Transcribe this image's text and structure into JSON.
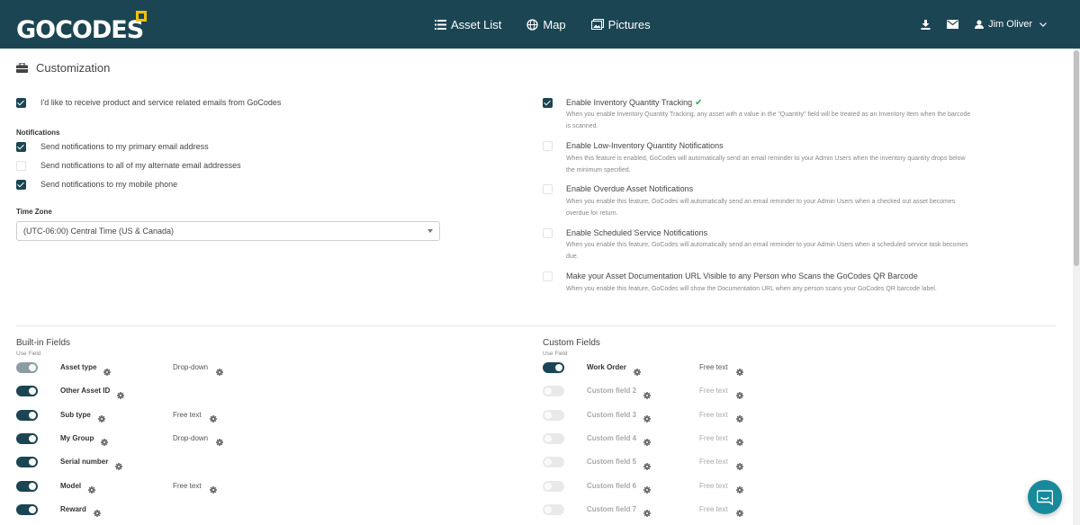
{
  "nav": {
    "logo": "GOCODES",
    "links": [
      "Asset List",
      "Map",
      "Pictures"
    ],
    "user": "Jim Oliver"
  },
  "page": {
    "title": "Customization",
    "marketing_email": "I'd like to receive product and service related emails from GoCodes",
    "notifications_heading": "Notifications",
    "notify_primary": "Send notifications to my primary email address",
    "notify_alternate": "Send notifications to all of my alternate email addresses",
    "notify_mobile": "Send notifications to my mobile phone",
    "timezone_label": "Time Zone",
    "timezone_value": "(UTC-06:00) Central Time (US & Canada)"
  },
  "features": [
    {
      "title": "Enable Inventory Quantity Tracking",
      "desc": "When you enable Inventory Quantity Tracking, any asset with a value in the \"Quantity\" field will be treated as an Inventory Item when the barcode is scanned.",
      "checked": true
    },
    {
      "title": "Enable Low-Inventory Quantity Notifications",
      "desc": "When this feature is enabled, GoCodes will automatically send an email reminder to your Admin Users when the inventory quantity drops below the minimum specified.",
      "checked": false
    },
    {
      "title": "Enable Overdue Asset Notifications",
      "desc": "When you enable this feature, GoCodes will automatically send an email reminder to your Admin Users when a checked out asset becomes overdue for return.",
      "checked": false
    },
    {
      "title": "Enable Scheduled Service Notifications",
      "desc": "When you enable this feature, GoCodes will automatically send an email reminder to your Admin Users when a scheduled service task becomes due.",
      "checked": false
    },
    {
      "title": "Make your Asset Documentation URL Visible to any Person who Scans the GoCodes QR Barcode",
      "desc": "When you enable this feature, GoCodes will show the Documentation URL when any person scans your GoCodes QR barcode label.",
      "checked": false
    }
  ],
  "builtin": {
    "title": "Built-in Fields",
    "use_field": "Use Field",
    "fields": [
      {
        "name": "Asset type",
        "type": "Drop-down",
        "state": "dim"
      },
      {
        "name": "Other Asset ID",
        "type": "",
        "state": "on"
      },
      {
        "name": "Sub type",
        "type": "Free text",
        "state": "on"
      },
      {
        "name": "My Group",
        "type": "Drop-down",
        "state": "on"
      },
      {
        "name": "Serial number",
        "type": "",
        "state": "on"
      },
      {
        "name": "Model",
        "type": "Free text",
        "state": "on"
      },
      {
        "name": "Reward",
        "type": "",
        "state": "on"
      }
    ]
  },
  "custom": {
    "title": "Custom Fields",
    "use_field": "Use Field",
    "fields": [
      {
        "name": "Work Order",
        "type": "Free text",
        "state": "on"
      },
      {
        "name": "Custom field 2",
        "type": "Free text",
        "state": "off"
      },
      {
        "name": "Custom field 3",
        "type": "Free text",
        "state": "off"
      },
      {
        "name": "Custom field 4",
        "type": "Free text",
        "state": "off"
      },
      {
        "name": "Custom field 5",
        "type": "Free text",
        "state": "off"
      },
      {
        "name": "Custom field 6",
        "type": "Free text",
        "state": "off"
      },
      {
        "name": "Custom field 7",
        "type": "Free text",
        "state": "off"
      }
    ]
  },
  "colors": {
    "nav": "#1b4553",
    "accent": "#f2c200",
    "fab": "#178a9b",
    "check": "#2eaa5a"
  }
}
